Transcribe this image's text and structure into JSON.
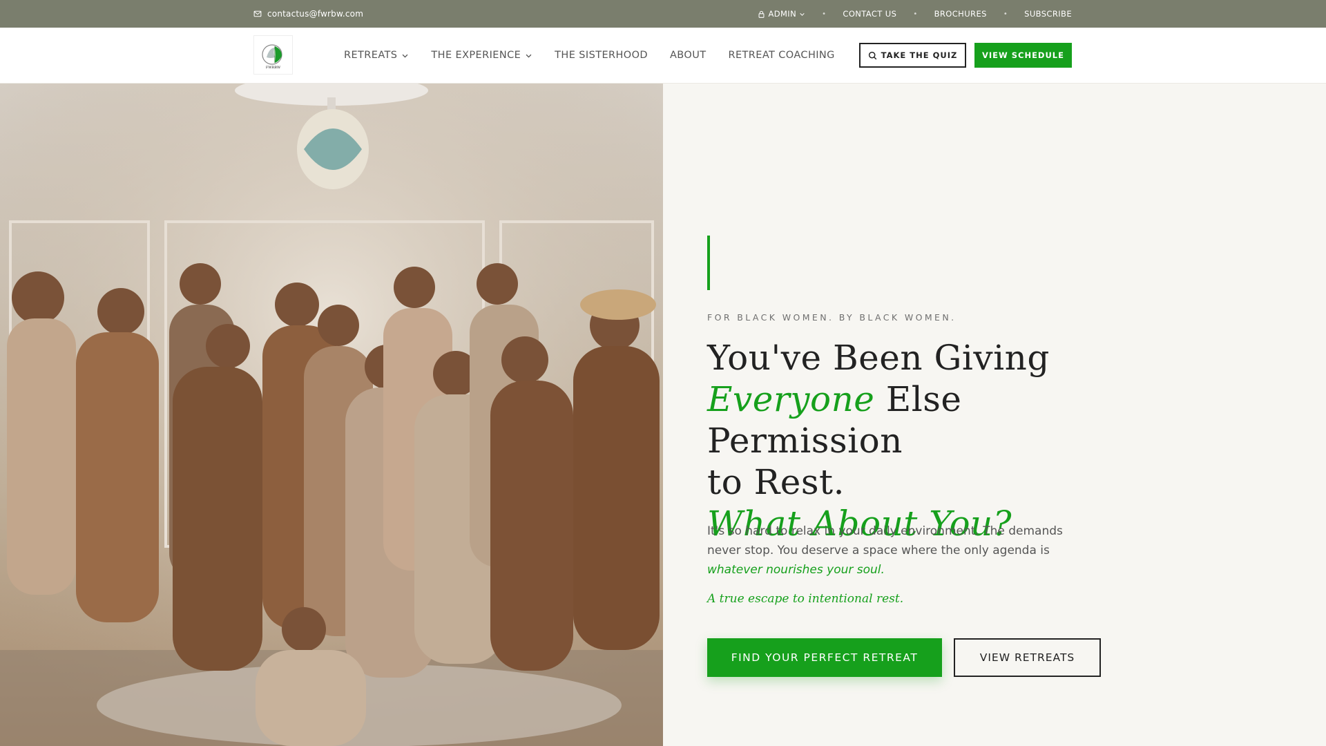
{
  "topbar": {
    "email": "contactus@fwrbw.com",
    "admin": "ADMIN",
    "links": [
      "CONTACT US",
      "BROCHURES",
      "SUBSCRIBE"
    ]
  },
  "nav": {
    "logo_text": "FWRBW",
    "items": [
      {
        "label": "RETREATS",
        "dropdown": true
      },
      {
        "label": "THE EXPERIENCE",
        "dropdown": true
      },
      {
        "label": "THE SISTERHOOD",
        "dropdown": false
      },
      {
        "label": "ABOUT",
        "dropdown": false
      },
      {
        "label": "RETREAT COACHING",
        "dropdown": false
      }
    ],
    "quiz_button": "TAKE THE QUIZ",
    "schedule_button": "VIEW SCHEDULE"
  },
  "hero": {
    "eyebrow": "FOR BLACK WOMEN. BY BLACK WOMEN.",
    "headline_1": "You've Been Giving",
    "headline_2_accent": "Everyone",
    "headline_2_rest": " Else Permission",
    "headline_3": "to Rest.",
    "headline_4_accent": "What About You?",
    "body_text": "It's so hard to relax in your daily environment. The demands never stop. You deserve a space where the only agenda is ",
    "body_emphasis": "whatever nourishes your soul.",
    "tagline": "A true escape to intentional rest.",
    "primary_cta": "FIND YOUR PERFECT RETREAT",
    "secondary_cta": "VIEW RETREATS"
  },
  "colors": {
    "accent": "#16a01c",
    "topbar": "#7a7e6d",
    "background": "#f7f6f2"
  }
}
